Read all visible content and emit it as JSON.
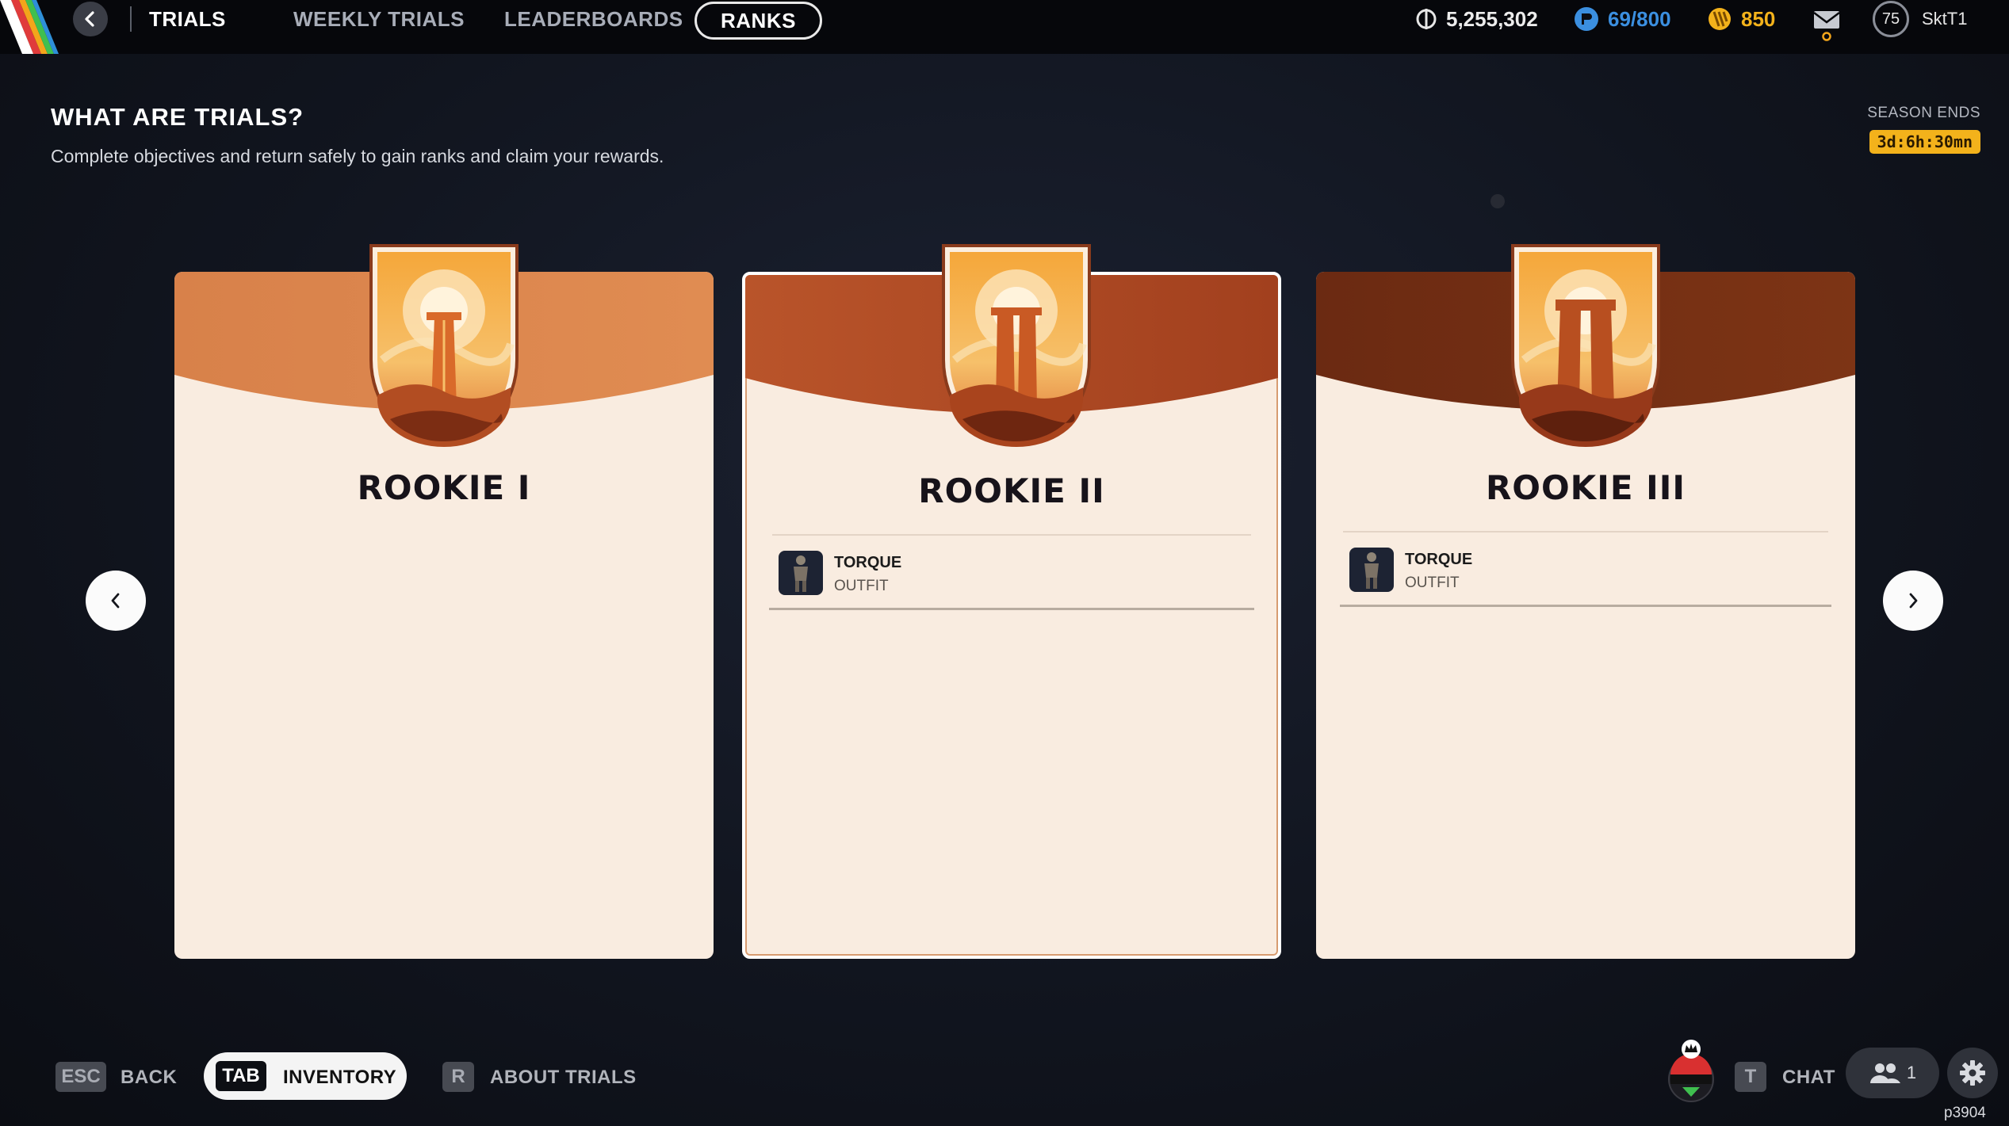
{
  "nav": {
    "tabs": [
      {
        "label": "TRIALS"
      },
      {
        "label": "WEEKLY TRIALS"
      },
      {
        "label": "LEADERBOARDS"
      },
      {
        "label": "RANKS"
      }
    ],
    "active_tab": "RANKS"
  },
  "currencies": {
    "credits": "5,255,302",
    "pass_progress": "69/800",
    "tokens": "850",
    "pass_color": "#3b8fe0",
    "token_color": "#f3b21b"
  },
  "player": {
    "level": "75",
    "username": "SktT1"
  },
  "header": {
    "title": "WHAT ARE TRIALS?",
    "subtitle": "Complete objectives and return safely to gain ranks and claim your rewards.",
    "season_label": "SEASON ENDS",
    "season_timer": "3d:6h:30mn"
  },
  "ranks": [
    {
      "title": "ROOKIE I",
      "rewards": []
    },
    {
      "title": "ROOKIE II",
      "rewards": [
        {
          "name": "TORQUE",
          "type": "OUTFIT"
        }
      ]
    },
    {
      "title": "ROOKIE III",
      "rewards": [
        {
          "name": "TORQUE",
          "type": "OUTFIT"
        }
      ]
    }
  ],
  "bottom": {
    "esc_key": "ESC",
    "back_label": "BACK",
    "tab_key": "TAB",
    "inventory_label": "INVENTORY",
    "r_key": "R",
    "about_label": "ABOUT TRIALS",
    "t_key": "T",
    "chat_label": "CHAT",
    "party_count": "1",
    "build_id": "p3904"
  }
}
